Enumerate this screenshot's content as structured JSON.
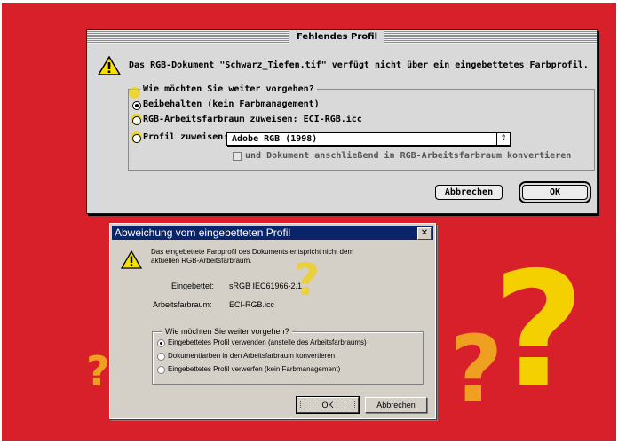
{
  "mac_dialog": {
    "title": "Fehlendes Profil",
    "message": "Das RGB-Dokument \"Schwarz_Tiefen.tif\" verfügt nicht über ein eingebettetes Farbprofil.",
    "group_label": "Wie möchten Sie weiter vorgehen?",
    "options": [
      {
        "label": "Beibehalten (kein Farbmanagement)",
        "selected": true
      },
      {
        "label": "RGB-Arbeitsfarbraum zuweisen: ECI-RGB.icc",
        "selected": false
      },
      {
        "label": "Profil zuweisen:",
        "selected": false
      }
    ],
    "profile_popup": "Adobe RGB (1998)",
    "convert_checkbox": {
      "label": "und Dokument anschließend in RGB-Arbeitsfarbraum konvertieren",
      "checked": false
    },
    "cancel_button": "Abbrechen",
    "ok_button": "OK"
  },
  "win_dialog": {
    "title": "Abweichung vom eingebetteten Profil",
    "close": "✕",
    "message_line1": "Das eingebettete Farbprofil des Dokuments entspricht nicht dem",
    "message_line2": "aktuellen RGB-Arbeitsfarbraum.",
    "embedded_label": "Eingebettet:",
    "embedded_value": "sRGB IEC61966-2.1",
    "workspace_label": "Arbeitsfarbraum:",
    "workspace_value": "ECI-RGB.icc",
    "group_label": "Wie möchten Sie weiter vorgehen?",
    "options": [
      {
        "label": "Eingebettetes Profil verwenden (anstelle des Arbeitsfarbraums)",
        "selected": true
      },
      {
        "label": "Dokumentfarben in den Arbeitsfarbraum konvertieren",
        "selected": false
      },
      {
        "label": "Eingebettetes Profil verwerfen (kein Farbmanagement)",
        "selected": false
      }
    ],
    "ok_button": "OK",
    "cancel_button": "Abbrechen"
  },
  "decorations": {
    "question_mark": "?"
  },
  "colors": {
    "background": "#d8202a",
    "question_yellow": "#f4d000",
    "question_orange": "#f0a020"
  }
}
